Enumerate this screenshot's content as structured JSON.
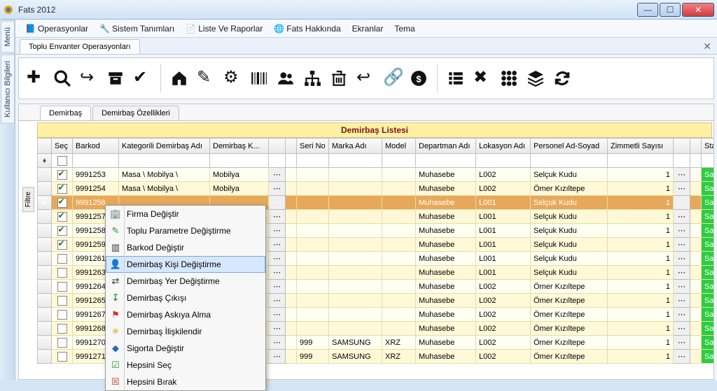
{
  "window": {
    "title": "Fats 2012"
  },
  "menubar": {
    "items": [
      {
        "label": "Operasyonlar"
      },
      {
        "label": "Sistem Tanımları"
      },
      {
        "label": "Liste Ve Raporlar"
      },
      {
        "label": "Fats Hakkında"
      },
      {
        "label": "Ekranlar"
      },
      {
        "label": "Tema"
      }
    ]
  },
  "leftbar": {
    "t1": "Menü",
    "t2": "Kullanıcı Bilgileri"
  },
  "subtab": {
    "label": "Toplu Envanter Operasyonları"
  },
  "gridtabs": {
    "t1": "Demirbaş",
    "t2": "Demirbaş Özellikleri",
    "filter": "Filtre"
  },
  "grid": {
    "title": "Demirbaş Listesi",
    "headers": {
      "sel": "Seç",
      "bar": "Barkod",
      "kat": "Kategorili Demirbaş Adı",
      "dk": "Demirbaş K...",
      "ser": "Seri No",
      "marka": "Marka Adı",
      "model": "Model",
      "dep": "Departman Adı",
      "lok": "Lokasyon Adı",
      "per": "Personel Ad-Soyad",
      "zim": "Zimmetli Sayısı",
      "stat": "Statü"
    },
    "rows": [
      {
        "chk": true,
        "bar": "9991253",
        "kat": "Masa \\ Mobilya \\",
        "dk": "Mobilya",
        "ser": "",
        "marka": "",
        "model": "",
        "dep": "Muhasebe",
        "lok": "L002",
        "per": "Selçuk Kudu",
        "zim": "1",
        "stat": "Sağlam"
      },
      {
        "chk": true,
        "bar": "9991254",
        "kat": "Masa \\ Mobilya \\",
        "dk": "Mobilya",
        "ser": "",
        "marka": "",
        "model": "",
        "dep": "Muhasebe",
        "lok": "L002",
        "per": "Ömer Kızıltepe",
        "zim": "1",
        "stat": "Sağlam"
      },
      {
        "chk": true,
        "bar": "9991256",
        "kat": "",
        "dk": "",
        "ser": "",
        "marka": "",
        "model": "",
        "dep": "Muhasebe",
        "lok": "L001",
        "per": "Selçuk Kudu",
        "zim": "1",
        "stat": "Sağlam",
        "selected": true,
        "arrow": true
      },
      {
        "chk": true,
        "bar": "9991257",
        "kat": "",
        "dk": "",
        "ser": "",
        "marka": "",
        "model": "",
        "dep": "Muhasebe",
        "lok": "L001",
        "per": "Selçuk Kudu",
        "zim": "1",
        "stat": "Sağlam"
      },
      {
        "chk": true,
        "bar": "9991258",
        "kat": "",
        "dk": "",
        "ser": "",
        "marka": "",
        "model": "",
        "dep": "Muhasebe",
        "lok": "L001",
        "per": "Selçuk Kudu",
        "zim": "1",
        "stat": "Sağlam"
      },
      {
        "chk": true,
        "bar": "9991259",
        "kat": "",
        "dk": "",
        "ser": "",
        "marka": "",
        "model": "",
        "dep": "Muhasebe",
        "lok": "L001",
        "per": "Selçuk Kudu",
        "zim": "1",
        "stat": "Sağlam"
      },
      {
        "chk": false,
        "bar": "9991261",
        "kat": "",
        "dk": "",
        "ser": "",
        "marka": "",
        "model": "",
        "dep": "Muhasebe",
        "lok": "L001",
        "per": "Selçuk Kudu",
        "zim": "1",
        "stat": "Sağlam"
      },
      {
        "chk": false,
        "bar": "9991263",
        "kat": "",
        "dk": "",
        "ser": "",
        "marka": "",
        "model": "",
        "dep": "Muhasebe",
        "lok": "L001",
        "per": "Selçuk Kudu",
        "zim": "1",
        "stat": "Sağlam"
      },
      {
        "chk": false,
        "bar": "9991264",
        "kat": "",
        "dk": "",
        "ser": "",
        "marka": "",
        "model": "",
        "dep": "Muhasebe",
        "lok": "L002",
        "per": "Ömer Kızıltepe",
        "zim": "1",
        "stat": "Sağlam"
      },
      {
        "chk": false,
        "bar": "9991265",
        "kat": "",
        "dk": "",
        "ser": "",
        "marka": "",
        "model": "",
        "dep": "Muhasebe",
        "lok": "L002",
        "per": "Ömer Kızıltepe",
        "zim": "1",
        "stat": "Sağlam"
      },
      {
        "chk": false,
        "bar": "9991267",
        "kat": "",
        "dk": "",
        "ser": "",
        "marka": "",
        "model": "",
        "dep": "Muhasebe",
        "lok": "L002",
        "per": "Ömer Kızıltepe",
        "zim": "1",
        "stat": "Sağlam"
      },
      {
        "chk": false,
        "bar": "9991268",
        "kat": "",
        "dk": "",
        "ser": "",
        "marka": "",
        "model": "",
        "dep": "Muhasebe",
        "lok": "L002",
        "per": "Ömer Kızıltepe",
        "zim": "1",
        "stat": "Sağlam"
      },
      {
        "chk": false,
        "bar": "9991270",
        "kat": "",
        "dk": "",
        "ser": "999",
        "marka": "SAMSUNG",
        "model": "XRZ",
        "dep": "Muhasebe",
        "lok": "L002",
        "per": "Ömer Kızıltepe",
        "zim": "1",
        "stat": "Sağlam"
      },
      {
        "chk": false,
        "bar": "9991271",
        "kat": "",
        "dk": "",
        "ser": "999",
        "marka": "SAMSUNG",
        "model": "XRZ",
        "dep": "Muhasebe",
        "lok": "L002",
        "per": "Ömer Kızıltepe",
        "zim": "1",
        "stat": "Sağlam"
      }
    ]
  },
  "context_menu": {
    "items": [
      {
        "label": "Firma Değiştir",
        "icon": "🏢"
      },
      {
        "label": "Toplu Parametre Değiştirme",
        "icon": "✎",
        "color": "#2a9d2a"
      },
      {
        "label": "Barkod Değiştir",
        "icon": "▥"
      },
      {
        "label": "Demirbaş Kişi Değiştirme",
        "icon": "👤",
        "hover": true
      },
      {
        "label": "Demirbaş Yer Değiştirme",
        "icon": "⇄"
      },
      {
        "label": "Demirbaş Çıkışı",
        "icon": "↧",
        "color": "#0a7a0a"
      },
      {
        "label": "Demirbaş Askıya Alma",
        "icon": "⚑",
        "color": "#c0392b"
      },
      {
        "label": "Demirbaş İlişkilendir",
        "icon": "✳",
        "color": "#d4a017"
      },
      {
        "label": "Sigorta Değiştir",
        "icon": "◆",
        "color": "#1e6fb8"
      },
      {
        "label": "Hepsini Seç",
        "icon": "☑",
        "color": "#2a9d2a"
      },
      {
        "label": "Hepsini Bırak",
        "icon": "☒",
        "color": "#c0392b"
      }
    ]
  }
}
